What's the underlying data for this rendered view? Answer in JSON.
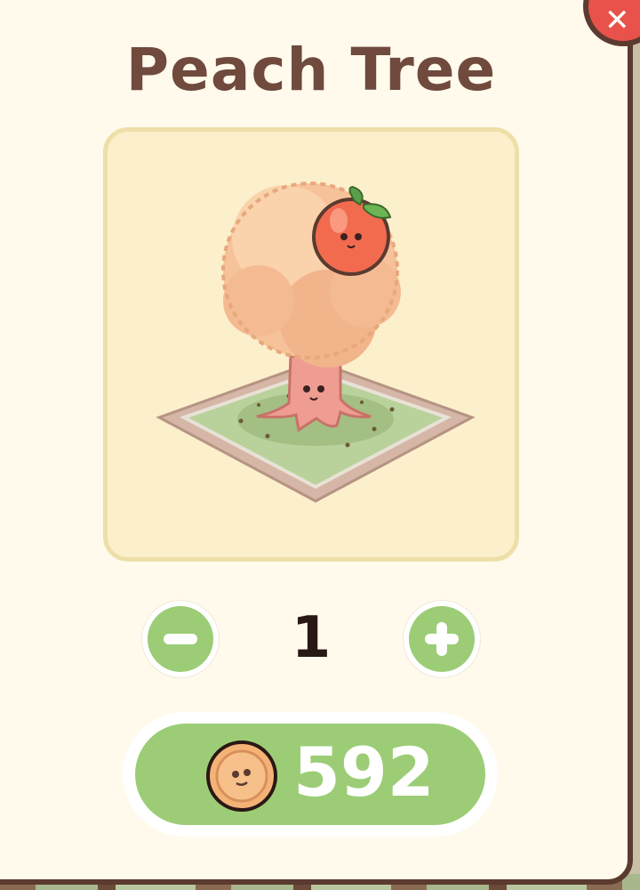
{
  "item": {
    "title": "Peach Tree"
  },
  "quantity": {
    "value": "1"
  },
  "purchase": {
    "price": "592",
    "currency_icon": "coin-icon"
  },
  "icons": {
    "close": "close-icon",
    "decrease": "minus-icon",
    "increase": "plus-icon"
  },
  "colors": {
    "panel_bg": "#fffaec",
    "panel_border": "#5b3a30",
    "title_text": "#6f4a3d",
    "button_green": "#9ccd76",
    "close_red": "#e8524a"
  }
}
